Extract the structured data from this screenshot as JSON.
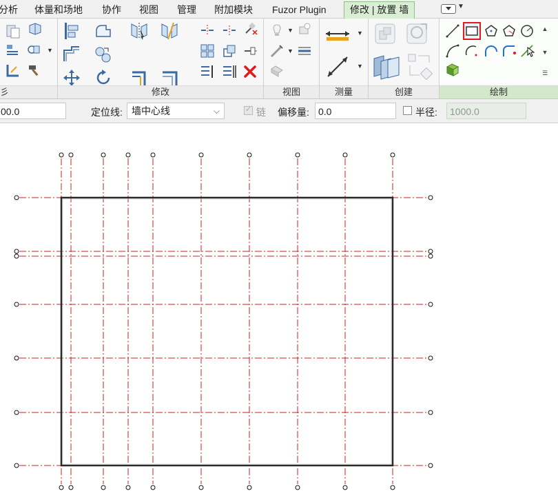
{
  "tabs": [
    {
      "label": "分析",
      "active": false
    },
    {
      "label": "体量和场地",
      "active": false
    },
    {
      "label": "协作",
      "active": false
    },
    {
      "label": "视图",
      "active": false
    },
    {
      "label": "管理",
      "active": false
    },
    {
      "label": "附加模块",
      "active": false
    },
    {
      "label": "Fuzor Plugin",
      "active": false
    },
    {
      "label": "修改 | 放置 墙",
      "active": true
    }
  ],
  "ribbon": {
    "panels": {
      "clipboard_partial": "彡",
      "modify": "修改",
      "view": "视图",
      "measure": "测量",
      "create": "创建",
      "draw": "绘制"
    }
  },
  "icons": {
    "modify": [
      "align",
      "offset",
      "mirror-axis",
      "mirror-draw",
      "move",
      "copy",
      "rotate",
      "trim-extend",
      "split",
      "array",
      "scale",
      "pin",
      "unpin",
      "delete"
    ],
    "draw": [
      "line-icon",
      "rectangle-icon",
      "inscribed-polygon-icon",
      "circumscribed-polygon-icon",
      "circle-icon",
      "start-end-arc-icon",
      "center-ends-arc-icon",
      "tangent-arc-icon",
      "fillet-arc-icon",
      "pick-lines-icon",
      "pick-faces-icon"
    ]
  },
  "options": {
    "height_value": "00.0",
    "location_line_label": "定位线:",
    "location_line_value": "墙中心线",
    "chain_label": "链",
    "offset_label": "偏移量:",
    "offset_value": "0.0",
    "radius_label": "半径:",
    "radius_value": "1000.0"
  },
  "colors": {
    "accent_tab": "#d9eed4",
    "grid_line": "#cc1f1f",
    "wall": "#1a1a1a",
    "selection": "#e21a1a"
  }
}
